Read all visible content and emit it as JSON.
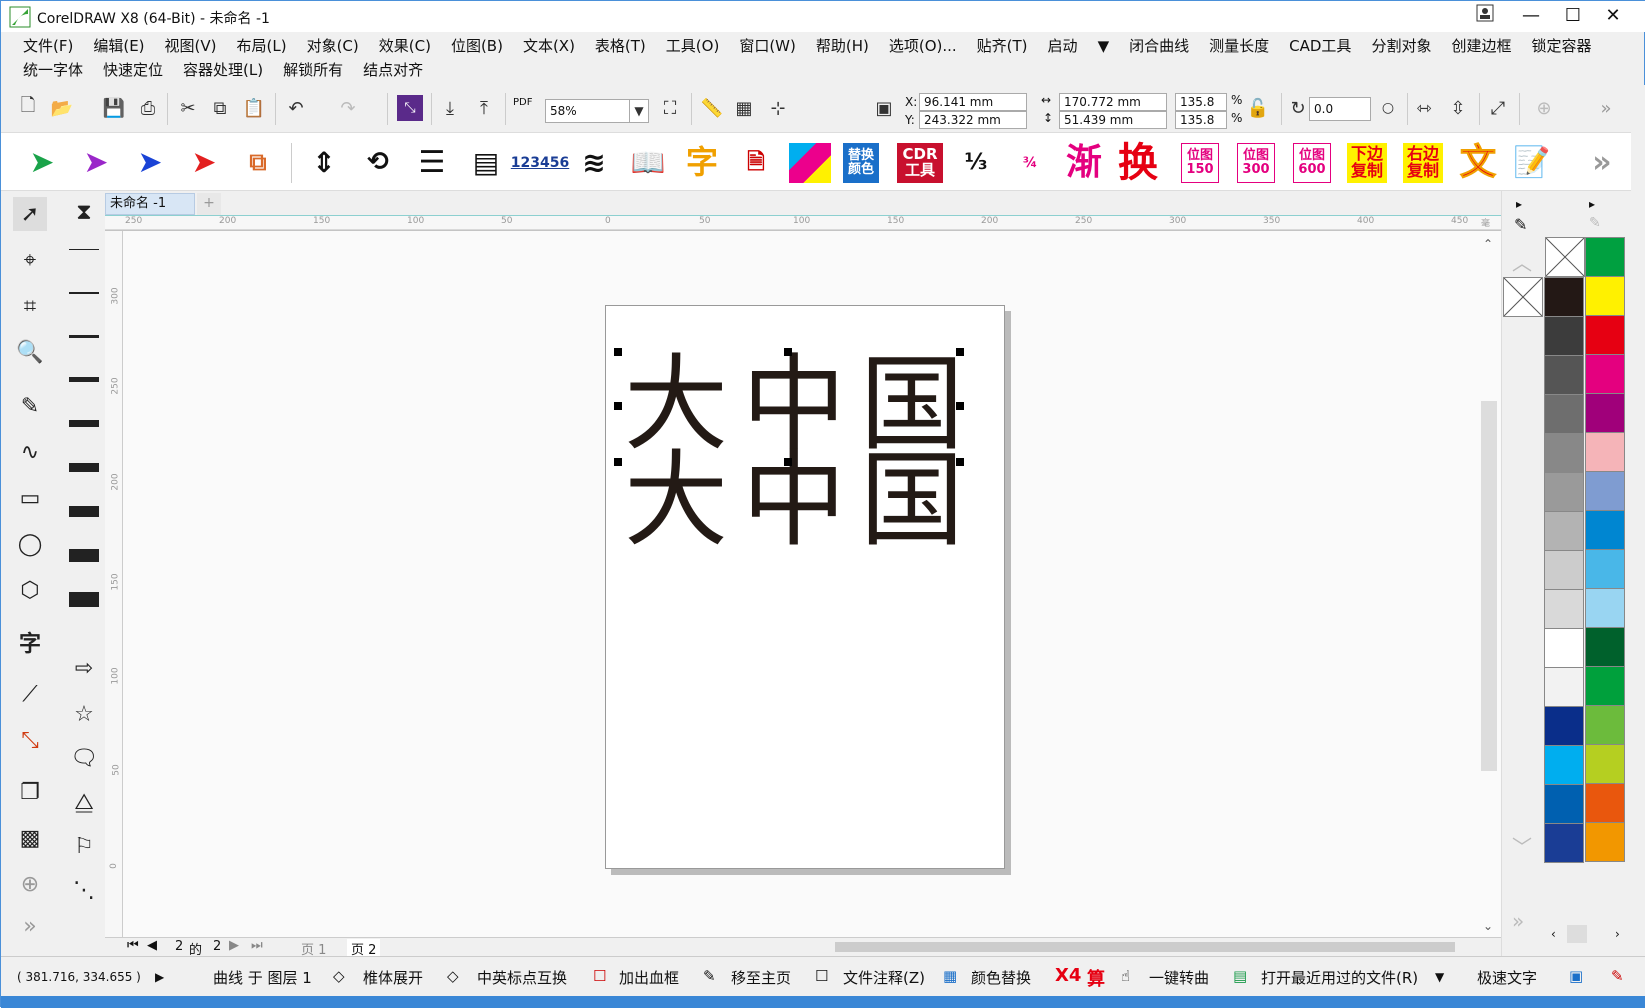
{
  "window": {
    "title": "CorelDRAW X8 (64-Bit) - 未命名 -1"
  },
  "menu": {
    "row1": [
      "文件(F)",
      "编辑(E)",
      "视图(V)",
      "布局(L)",
      "对象(C)",
      "效果(C)",
      "位图(B)",
      "文本(X)",
      "表格(T)",
      "工具(O)",
      "窗口(W)",
      "帮助(H)",
      "选项(O)...",
      "贴齐(T)",
      "启动",
      "▼",
      "闭合曲线",
      "测量长度",
      "CAD工具",
      "分割对象",
      "创建边框",
      "锁定容器"
    ],
    "row2": [
      "统一字体",
      "快速定位",
      "容器处理(L)",
      "解锁所有",
      "结点对齐"
    ]
  },
  "toolbar": {
    "zoom": "58%",
    "pdf_label": "PDF",
    "x_label": "X:",
    "y_label": "Y:",
    "x_value": "96.141 mm",
    "y_value": "243.322 mm",
    "w_value": "170.772 mm",
    "h_value": "51.439 mm",
    "scale_x": "135.8",
    "scale_y": "135.8",
    "pct": "%",
    "rotation": "0.0"
  },
  "plugins": {
    "replace_color": "替换颜色",
    "cdr_tools": "CDR工具",
    "gradient": "渐",
    "swap": "换",
    "bitmap150": "位图150",
    "bitmap300": "位图300",
    "bitmap600": "位图600",
    "copy_bottom": "下边复制",
    "copy_right": "右边复制",
    "text": "文",
    "char": "字",
    "num": "123456"
  },
  "document": {
    "tab": "未命名 -1",
    "glyphs_row1": [
      "大",
      "中",
      "国"
    ],
    "glyphs_row2": [
      "大",
      "中",
      "国"
    ]
  },
  "ruler": {
    "h_ticks": [
      "250",
      "200",
      "150",
      "100",
      "50",
      "0",
      "50",
      "100",
      "150",
      "200",
      "250",
      "300",
      "350",
      "400",
      "450",
      "毫米"
    ],
    "v_ticks": [
      "300",
      "250",
      "200",
      "150",
      "100",
      "50",
      "0"
    ]
  },
  "pager": {
    "current": "2",
    "of": "的",
    "total": "2",
    "page1": "页 1",
    "page2": "页 2"
  },
  "status": {
    "coords": "( 381.716, 334.655 )",
    "object_info": "曲线 于 图层 1",
    "items": [
      "椎体展开",
      "中英标点互换",
      "加出血框",
      "移至主页",
      "文件注释(Z)",
      "颜色替换",
      "一键转曲",
      "打开最近用过的文件(R)",
      "极速文字"
    ],
    "x4": "X4",
    "calc": "算"
  },
  "palette": {
    "col1": [
      "#231815",
      "#3c3c3c",
      "#555555",
      "#6e6e6e",
      "#888888",
      "#9a9a9a",
      "#b3b3b3",
      "#cccccc",
      "#d9d9d9",
      "#ffffff",
      "#f2f2f2",
      "#0a2e8a",
      "#00aeef",
      "#0060b0",
      "#1a3d95"
    ],
    "col2": [
      "#00a040",
      "#fff100",
      "#e60012",
      "#e4007f",
      "#a0007a",
      "#f5b4b8",
      "#7f9cd1",
      "#0086d1",
      "#49b7e8",
      "#99d5f2",
      "#00612c",
      "#00a03c",
      "#6cbb3c",
      "#b5cf21",
      "#e9570d",
      "#f29700"
    ]
  }
}
